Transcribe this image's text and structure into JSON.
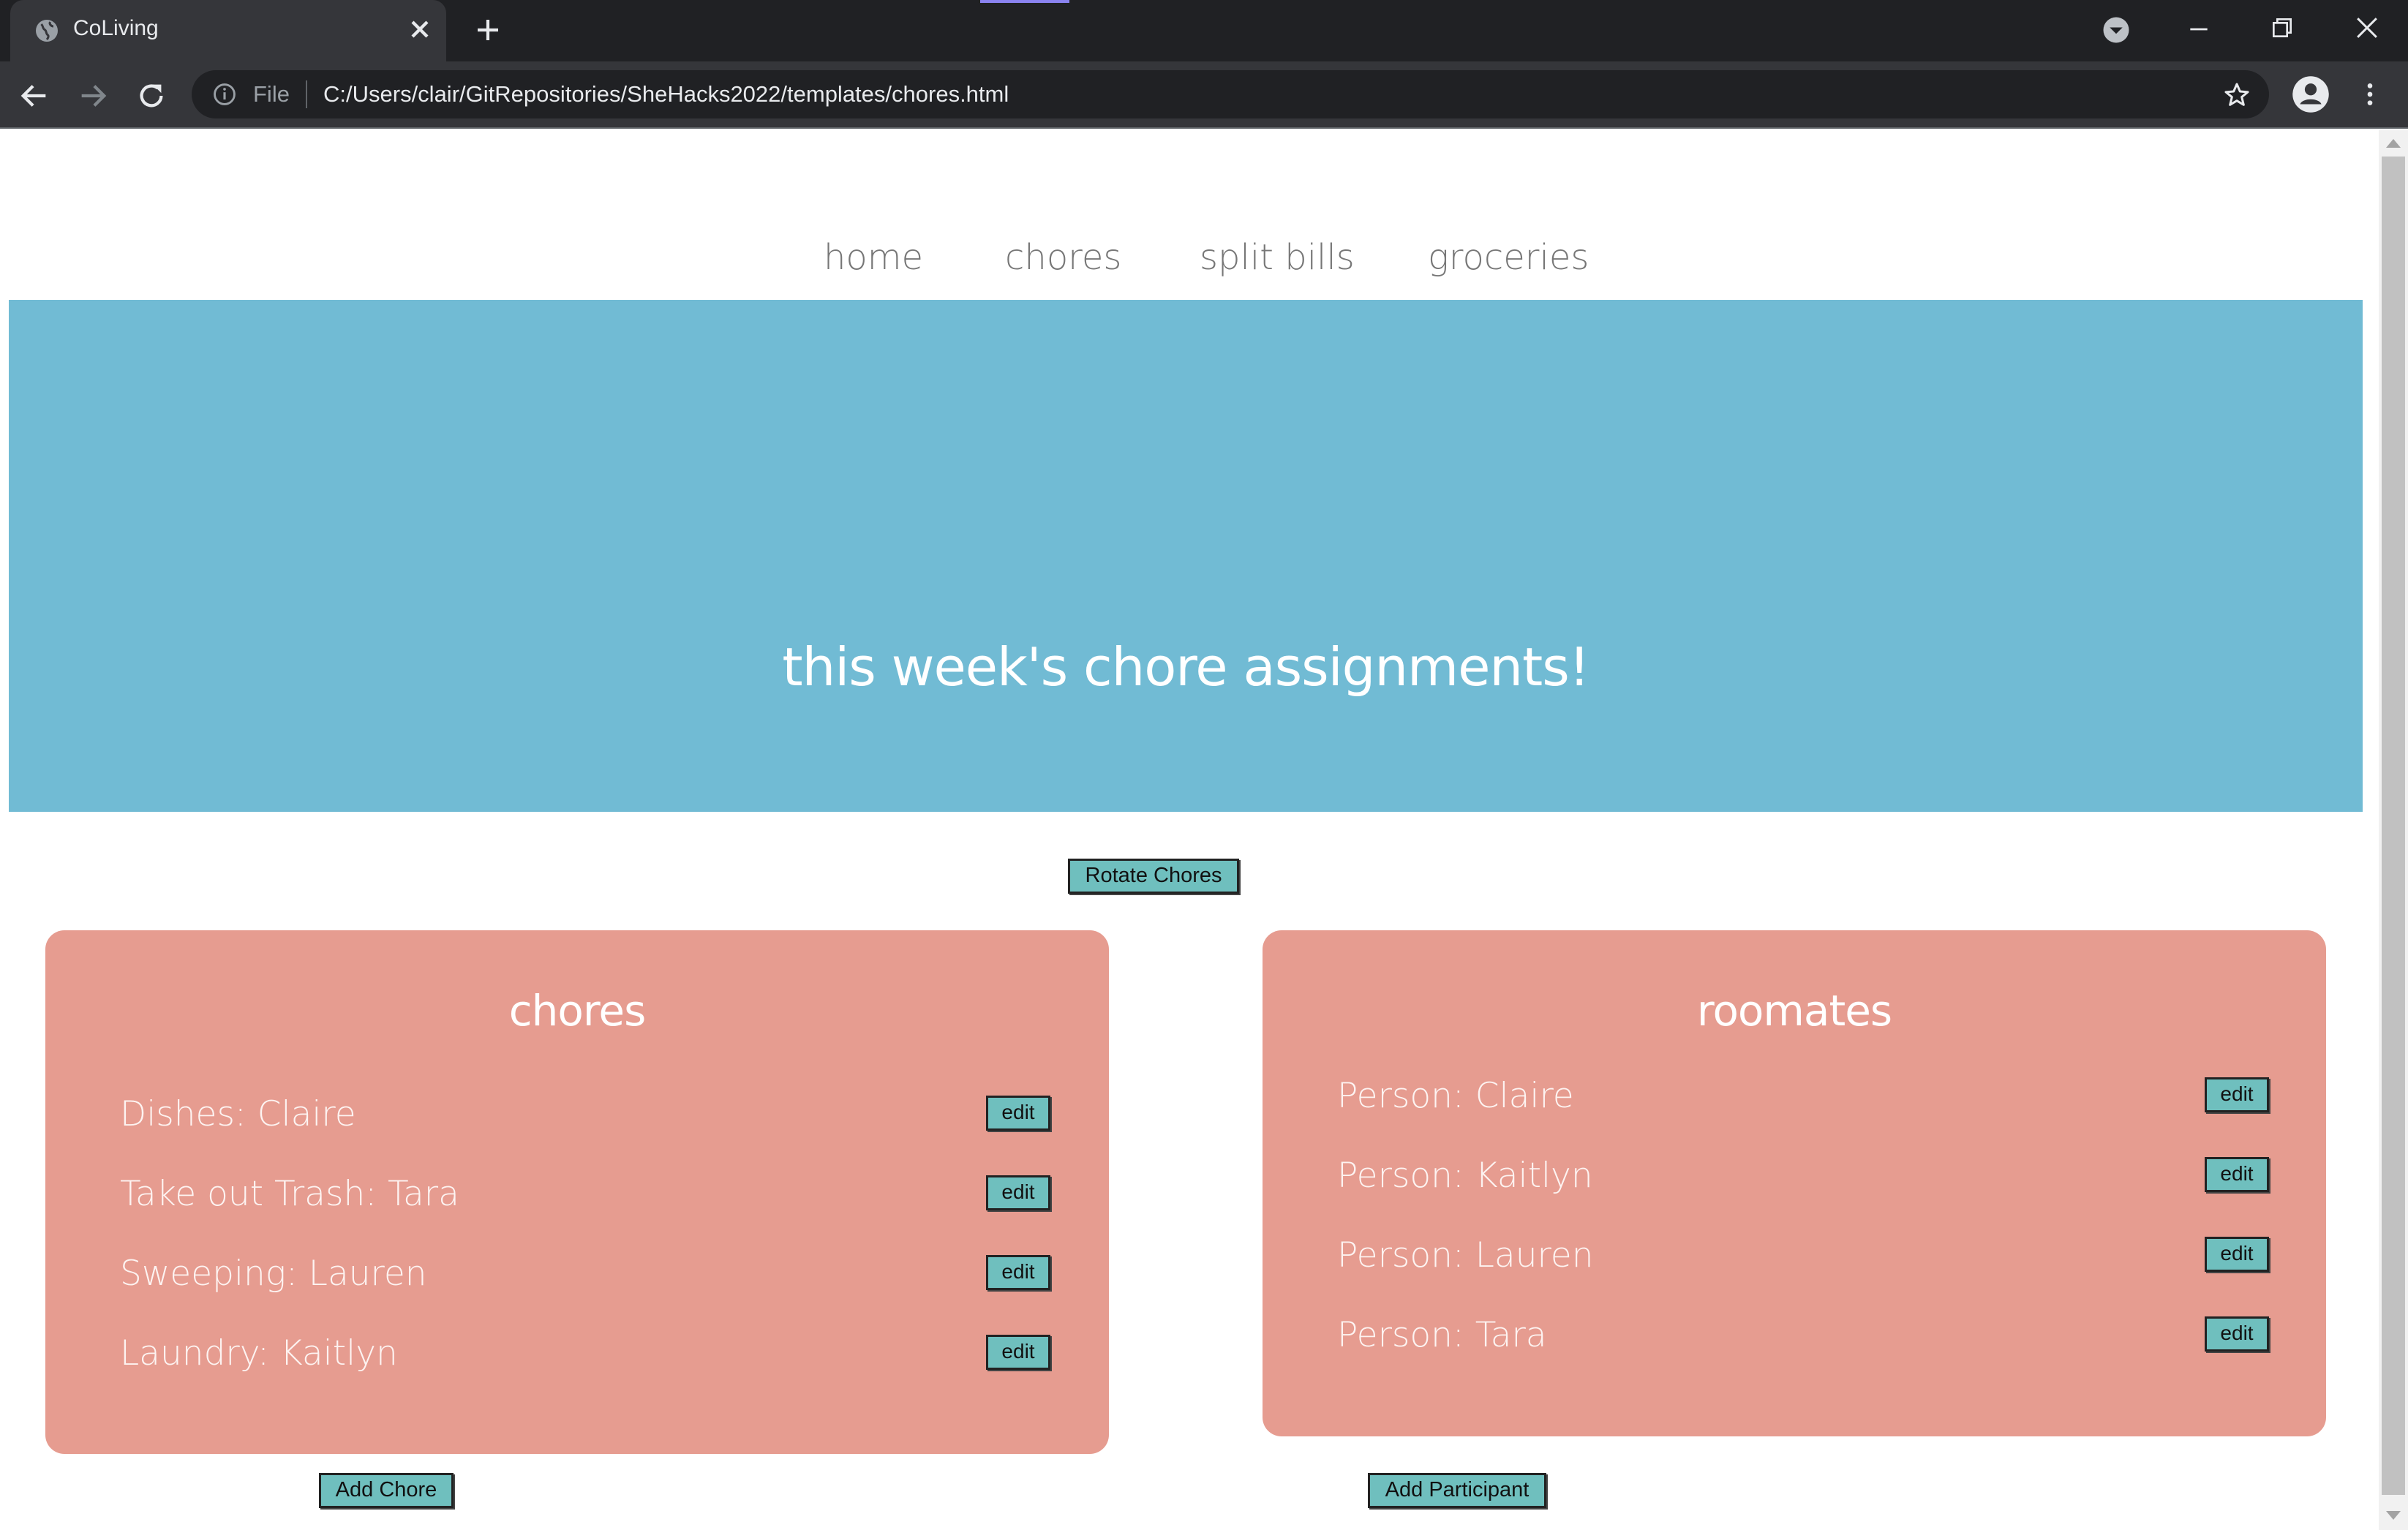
{
  "browser": {
    "tab_title": "CoLiving",
    "address_prefix": "File",
    "url": "C:/Users/clair/GitRepositories/SheHacks2022/templates/chores.html"
  },
  "nav": {
    "home": "home",
    "chores": "chores",
    "split_bills": "split bills",
    "groceries": "groceries"
  },
  "hero": {
    "title": "this week's chore assignments!"
  },
  "rotate_button": "Rotate Chores",
  "chores_card": {
    "title": "chores",
    "items": [
      {
        "text": "Dishes: Claire",
        "edit": "edit"
      },
      {
        "text": "Take out Trash: Tara",
        "edit": "edit"
      },
      {
        "text": "Sweeping: Lauren",
        "edit": "edit"
      },
      {
        "text": "Laundry: Kaitlyn",
        "edit": "edit"
      }
    ],
    "add_button": "Add Chore"
  },
  "roommates_card": {
    "title": "roomates",
    "items": [
      {
        "text": "Person: Claire",
        "edit": "edit"
      },
      {
        "text": "Person: Kaitlyn",
        "edit": "edit"
      },
      {
        "text": "Person: Lauren",
        "edit": "edit"
      },
      {
        "text": "Person: Tara",
        "edit": "edit"
      }
    ],
    "add_button": "Add Participant"
  },
  "colors": {
    "hero": "#71bbd4",
    "card": "#e69c90",
    "button": "#6fbfbe"
  }
}
